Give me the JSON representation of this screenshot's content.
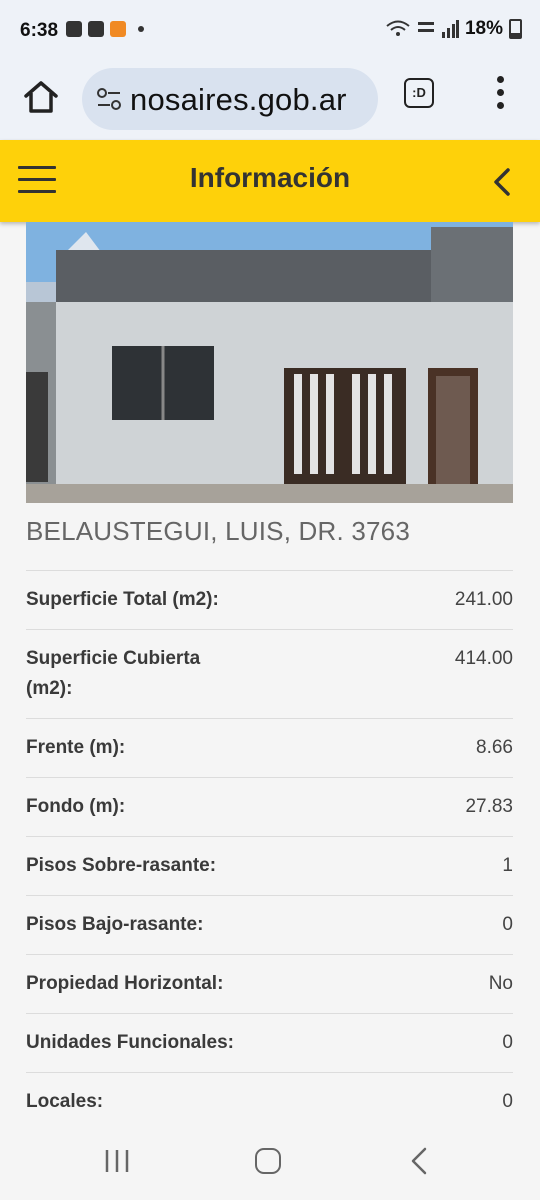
{
  "status_bar": {
    "time": "6:38",
    "battery": "18%",
    "icons": [
      "gallery-icon",
      "media-icon",
      "app-notification-icon",
      "dot-icon",
      "wifi-icon",
      "volte-icon",
      "signal-icon",
      "battery-icon"
    ]
  },
  "browser": {
    "url": "nosaires.gob.ar",
    "tab_label": ":D"
  },
  "header": {
    "title": "Información"
  },
  "property": {
    "address": "BELAUSTEGUI, LUIS, DR. 3763",
    "rows": [
      {
        "label": "Superficie Total (m2):",
        "value": "241.00"
      },
      {
        "label": "Superficie Cubierta (m2):",
        "value": "414.00"
      },
      {
        "label": "Frente (m):",
        "value": "8.66"
      },
      {
        "label": "Fondo (m):",
        "value": "27.83"
      },
      {
        "label": "Pisos Sobre-rasante:",
        "value": "1"
      },
      {
        "label": "Pisos Bajo-rasante:",
        "value": "0"
      },
      {
        "label": "Propiedad Horizontal:",
        "value": "No"
      },
      {
        "label": "Unidades Funcionales:",
        "value": "0"
      },
      {
        "label": "Locales:",
        "value": "0"
      }
    ]
  },
  "colors": {
    "header_bg": "#fed10a",
    "browser_bg": "#eef2f8",
    "url_pill": "#d9e2ef",
    "page_bg": "#f5f5f5"
  }
}
